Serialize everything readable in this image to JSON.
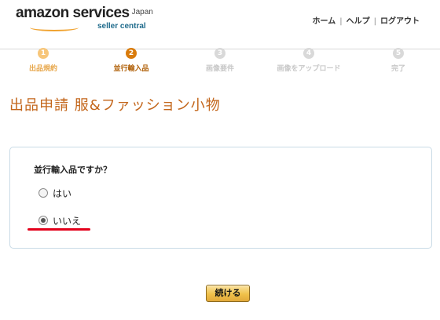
{
  "header": {
    "logo_brand": "amazon services",
    "logo_region": "Japan",
    "logo_sub": "seller central",
    "links": [
      "ホーム",
      "ヘルプ",
      "ログアウト"
    ],
    "separator": "|"
  },
  "steps": [
    {
      "num": "1",
      "label": "出品規約",
      "state": "done"
    },
    {
      "num": "2",
      "label": "並行輸入品",
      "state": "active"
    },
    {
      "num": "3",
      "label": "画像要件",
      "state": "pending"
    },
    {
      "num": "4",
      "label": "画像をアップロード",
      "state": "pending"
    },
    {
      "num": "5",
      "label": "完了",
      "state": "pending"
    }
  ],
  "page_title": "出品申請 服&ファッション小物",
  "form": {
    "question": "並行輸入品ですか？",
    "options": [
      {
        "label": "はい",
        "selected": false
      },
      {
        "label": "いいえ",
        "selected": true
      }
    ]
  },
  "continue_label": "続ける",
  "colors": {
    "accent": "#c3661b",
    "step_active": "#d97b0b",
    "annotation": "#e3001b"
  }
}
